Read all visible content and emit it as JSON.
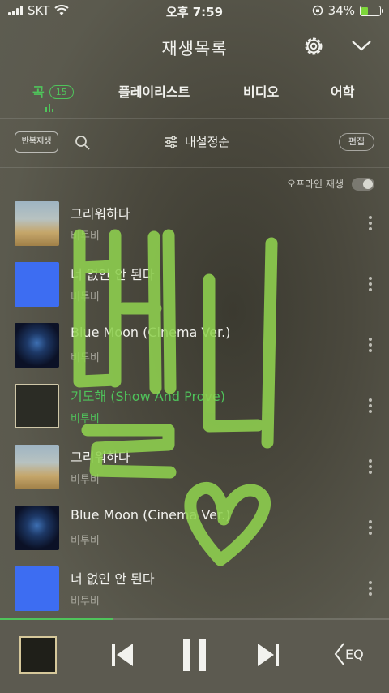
{
  "status_bar": {
    "carrier": "SKT",
    "time": "오후 7:59",
    "battery_text": "34%",
    "battery_level": 0.34
  },
  "header": {
    "title": "재생목록",
    "settings_icon": "gear-icon",
    "collapse_icon": "chevron-down-icon"
  },
  "tabs": [
    {
      "label": "곡",
      "badge": "15",
      "active": true
    },
    {
      "label": "플레이리스트"
    },
    {
      "label": "비디오"
    },
    {
      "label": "어학"
    }
  ],
  "toolbar": {
    "repeat_label": "반복재생",
    "sort_label": "내설정순",
    "edit_label": "편집"
  },
  "offline": {
    "label": "오프라인 재생",
    "enabled": false
  },
  "songs": [
    {
      "title": "그리워하다",
      "artist": "비투비",
      "art": "field"
    },
    {
      "title": "너 없인 안 된다",
      "artist": "비투비",
      "art": "blue"
    },
    {
      "title": "Blue Moon (Cinema Ver.)",
      "artist": "비투비",
      "art": "moon"
    },
    {
      "title": "기도해 (Show And Prove)",
      "artist": "비투비",
      "art": "square",
      "playing": true
    },
    {
      "title": "그리워하다",
      "artist": "비투비",
      "art": "field"
    },
    {
      "title": "Blue Moon (Cinema Ver.)",
      "artist": "비투비",
      "art": "moon"
    },
    {
      "title": "너 없인 안 된다",
      "artist": "비투비",
      "art": "blue"
    }
  ],
  "player": {
    "progress": 0.29,
    "eq_label": "EQ"
  },
  "doodle": {
    "text": "뻴디",
    "color": "#8fd14f"
  }
}
